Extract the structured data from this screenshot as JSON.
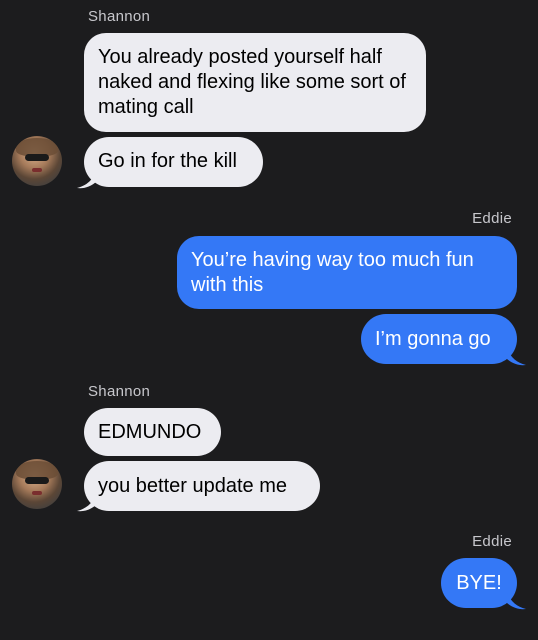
{
  "conversation": {
    "groups": [
      {
        "sender": "Shannon",
        "messages": [
          "You already posted yourself half naked and flexing like some sort of mating call",
          "Go in for the kill"
        ]
      },
      {
        "sender": "Eddie",
        "messages": [
          "You’re having way too much fun with this",
          "I’m gonna go"
        ]
      },
      {
        "sender": "Shannon",
        "messages": [
          "EDMUNDO",
          "you better update me"
        ]
      },
      {
        "sender": "Eddie",
        "messages": [
          "BYE!"
        ]
      }
    ]
  },
  "colors": {
    "background": "#1c1c1e",
    "incoming_bubble": "#ececf1",
    "outgoing_bubble": "#3478f6",
    "sender_label": "#c7c7cc"
  }
}
